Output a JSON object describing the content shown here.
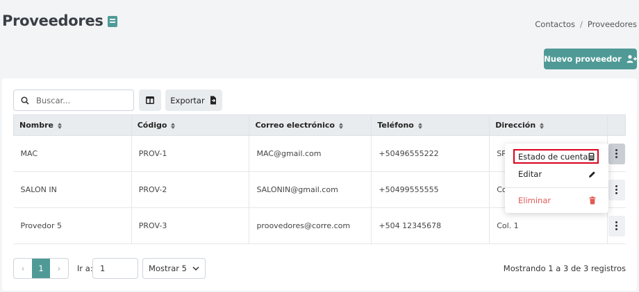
{
  "header": {
    "title": "Proveedores",
    "breadcrumb": [
      "Contactos",
      "Proveedores"
    ],
    "breadcrumb_sep": "/",
    "new_button": "Nuevo proveedor"
  },
  "toolbar": {
    "search_placeholder": "Buscar...",
    "export_label": "Exportar"
  },
  "table": {
    "columns": [
      "Nombre",
      "Código",
      "Correo electrónico",
      "Teléfono",
      "Dirección"
    ],
    "rows": [
      {
        "nombre": "MAC",
        "codigo": "PROV-1",
        "correo": "MAC@gmail.com",
        "telefono": "+50496555222",
        "direccion": "SP"
      },
      {
        "nombre": "SALON IN",
        "codigo": "PROV-2",
        "correo": "SALONIN@gmail.com",
        "telefono": "+50499555555",
        "direccion": "Co"
      },
      {
        "nombre": "Provedor 5",
        "codigo": "PROV-3",
        "correo": "proovedores@corre.com",
        "telefono": "+504 12345678",
        "direccion": "Col. 1"
      }
    ]
  },
  "row_menu": {
    "items": [
      "Estado de cuenta",
      "Editar",
      "Eliminar"
    ]
  },
  "pagination": {
    "prev": "‹",
    "current_page": "1",
    "next": "›",
    "goto_label": "Ir a:",
    "goto_value": "1",
    "page_size_label": "Mostrar 5",
    "records_text": "Mostrando 1 a 3 de 3 registros"
  },
  "colors": {
    "accent": "#4f9a96",
    "danger": "#e05a56",
    "highlight_border": "#d9001b"
  }
}
